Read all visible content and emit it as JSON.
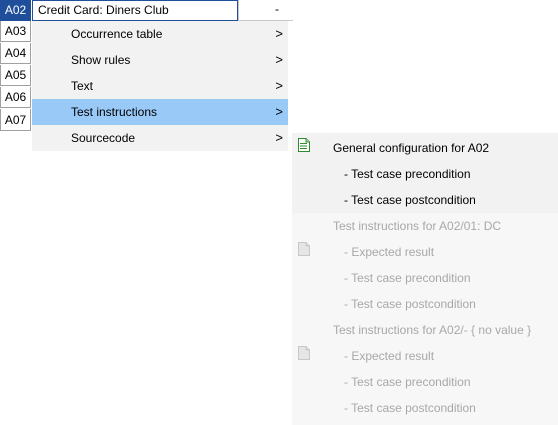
{
  "grid": {
    "row_headers": [
      "A02",
      "A03",
      "A04",
      "A05",
      "A06",
      "A07"
    ],
    "selected_row": "A02",
    "a02_value": "Credit Card: Diners Club",
    "a02_right_value": "-"
  },
  "menu": {
    "items": [
      {
        "label": "Occurrence table",
        "arrow": ">"
      },
      {
        "label": "Show rules",
        "arrow": ">"
      },
      {
        "label": "Text",
        "arrow": ">"
      },
      {
        "label": "Test instructions",
        "arrow": ">",
        "active": true
      },
      {
        "label": "Sourcecode",
        "arrow": ">"
      }
    ]
  },
  "submenu": {
    "group1": {
      "title": "General configuration for A02",
      "items": [
        "- Test case precondition",
        "- Test case postcondition"
      ],
      "icon": "document-icon-green",
      "enabled": true
    },
    "group2": {
      "title": "Test instructions for A02/01:  DC",
      "items": [
        "- Expected result",
        "- Test case precondition",
        "- Test case postcondition"
      ],
      "icon": "document-icon-gray",
      "enabled": false
    },
    "group3": {
      "title": "Test instructions for A02/- { no value }",
      "items": [
        "- Expected result",
        "- Test case precondition",
        "- Test case postcondition"
      ],
      "icon": "document-icon-gray",
      "enabled": false
    }
  },
  "colors": {
    "selected_row_bg": "#1f4e9a",
    "menu_active_bg": "#99c9f7",
    "menu_bg": "#f2f2f2",
    "disabled_text": "#a8a8a8"
  }
}
